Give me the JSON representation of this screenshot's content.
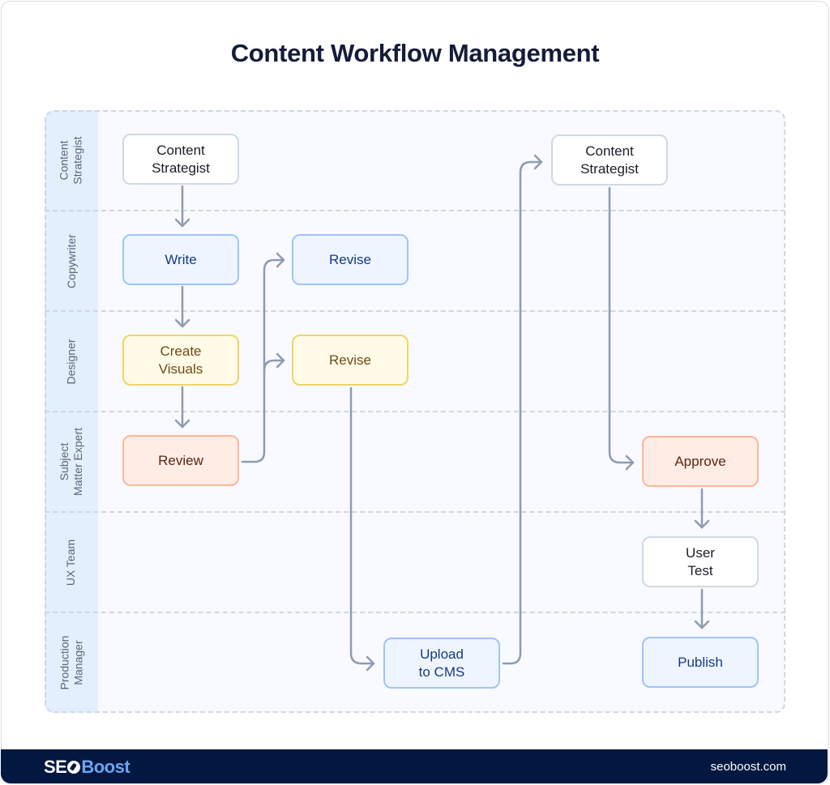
{
  "title": "Content Workflow Management",
  "lanes": [
    {
      "label": "Content\nStrategist"
    },
    {
      "label": "Copywriter"
    },
    {
      "label": "Designer"
    },
    {
      "label": "Subject\nMatter Expert"
    },
    {
      "label": "UX Team"
    },
    {
      "label": "Production\nManager"
    }
  ],
  "nodes": {
    "cs1": {
      "label": "Content\nStrategist",
      "lane": "Content Strategist",
      "style": "white"
    },
    "write": {
      "label": "Write",
      "lane": "Copywriter",
      "style": "blue"
    },
    "create_visuals": {
      "label": "Create\nVisuals",
      "lane": "Designer",
      "style": "yellow"
    },
    "review": {
      "label": "Review",
      "lane": "Subject Matter Expert",
      "style": "orange"
    },
    "revise_copy": {
      "label": "Revise",
      "lane": "Copywriter",
      "style": "blue"
    },
    "revise_design": {
      "label": "Revise",
      "lane": "Designer",
      "style": "yellow"
    },
    "upload": {
      "label": "Upload\nto CMS",
      "lane": "Production Manager",
      "style": "blue"
    },
    "cs2": {
      "label": "Content\nStrategist",
      "lane": "Content Strategist",
      "style": "white"
    },
    "approve": {
      "label": "Approve",
      "lane": "Subject Matter Expert",
      "style": "orange"
    },
    "user_test": {
      "label": "User\nTest",
      "lane": "UX Team",
      "style": "white"
    },
    "publish": {
      "label": "Publish",
      "lane": "Production Manager",
      "style": "blue"
    }
  },
  "edges": [
    {
      "from": "cs1",
      "to": "write"
    },
    {
      "from": "write",
      "to": "create_visuals"
    },
    {
      "from": "create_visuals",
      "to": "review"
    },
    {
      "from": "review",
      "to": "revise_copy"
    },
    {
      "from": "review",
      "to": "revise_design"
    },
    {
      "from": "revise_design",
      "to": "upload"
    },
    {
      "from": "upload",
      "to": "cs2"
    },
    {
      "from": "cs2",
      "to": "approve"
    },
    {
      "from": "approve",
      "to": "user_test"
    },
    {
      "from": "user_test",
      "to": "publish"
    }
  ],
  "colors": {
    "title": "#141c3a",
    "arrow": "#8e9bb0",
    "lane_label_bg": "#e3effd",
    "footer_bg": "#031840",
    "brand_accent": "#6ea4f4"
  },
  "footer": {
    "brand_seo": "SE",
    "brand_boost": "Boost",
    "brand_icon": "rocket-icon",
    "site": "seoboost.com"
  }
}
